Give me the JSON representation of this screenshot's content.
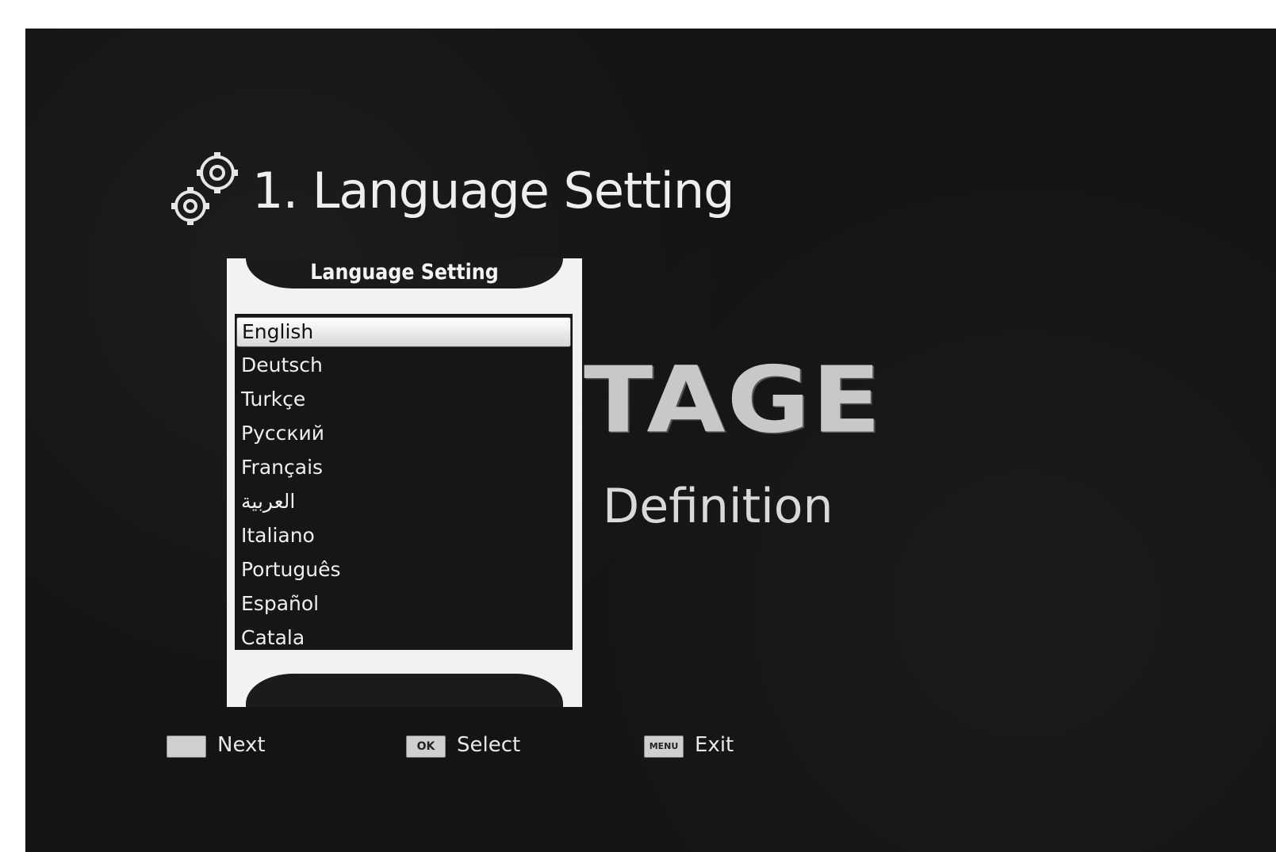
{
  "header": {
    "title": "1. Language Setting",
    "icon": "gear-icon"
  },
  "background": {
    "brand_text": "TAGE",
    "brand_subtitle": "Definition"
  },
  "dialog": {
    "title": "Language Setting",
    "selected_index": 0,
    "languages": [
      {
        "label": "English"
      },
      {
        "label": "Deutsch"
      },
      {
        "label": "Turkçe"
      },
      {
        "label": "Русский"
      },
      {
        "label": "Français"
      },
      {
        "label": "العربية"
      },
      {
        "label": "Italiano"
      },
      {
        "label": "Português"
      },
      {
        "label": "Español"
      },
      {
        "label": "Catala"
      }
    ]
  },
  "footer": {
    "next": {
      "key": "",
      "label": "Next"
    },
    "select": {
      "key": "OK",
      "label": "Select"
    },
    "exit": {
      "key": "MENU",
      "label": "Exit"
    }
  },
  "colors": {
    "screen_bg": "#141414",
    "dialog_frame": "#f2f2f2",
    "selection": "#e6e6e6",
    "text": "#eeeeee"
  }
}
